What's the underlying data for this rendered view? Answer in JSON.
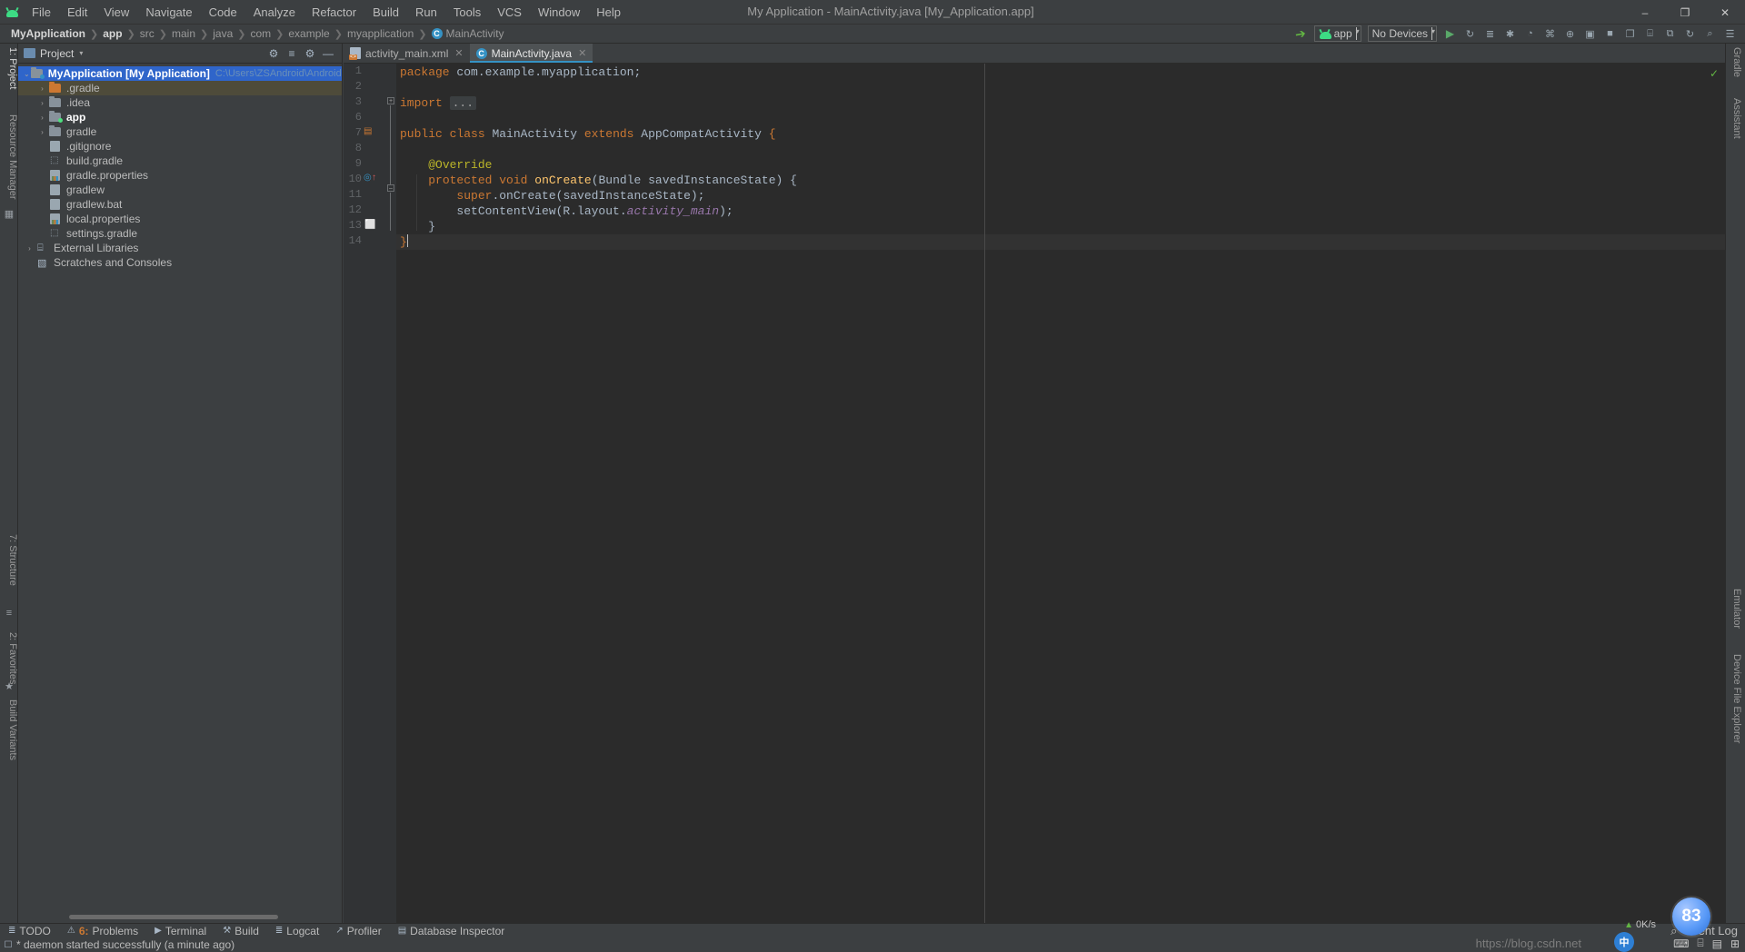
{
  "window": {
    "title": "My Application - MainActivity.java [My_Application.app]",
    "logo_icon": "android-logo-icon",
    "minimize_label": "–",
    "maximize_label": "❐",
    "close_label": "✕"
  },
  "menubar": {
    "items": [
      {
        "label": "File"
      },
      {
        "label": "Edit"
      },
      {
        "label": "View"
      },
      {
        "label": "Navigate"
      },
      {
        "label": "Code"
      },
      {
        "label": "Analyze"
      },
      {
        "label": "Refactor"
      },
      {
        "label": "Build"
      },
      {
        "label": "Run"
      },
      {
        "label": "Tools"
      },
      {
        "label": "VCS"
      },
      {
        "label": "Window"
      },
      {
        "label": "Help"
      }
    ]
  },
  "breadcrumb": {
    "items": [
      {
        "label": "MyApplication",
        "bold": true
      },
      {
        "label": "app",
        "bold": true
      },
      {
        "label": "src",
        "bold": false
      },
      {
        "label": "main",
        "bold": false
      },
      {
        "label": "java",
        "bold": false
      },
      {
        "label": "com",
        "bold": false
      },
      {
        "label": "example",
        "bold": false
      },
      {
        "label": "myapplication",
        "bold": false
      },
      {
        "label": "MainActivity",
        "bold": false,
        "badge": "C"
      }
    ],
    "separator": "❯"
  },
  "toolbar": {
    "build_icon": "hammer-icon",
    "run_config": {
      "label": "app",
      "icon": "android-app-icon",
      "caret": "▾"
    },
    "device_selector": {
      "label": "No Devices",
      "caret": "▾"
    },
    "run_icon": "run-play-icon",
    "rerun_icon": "apply-changes-icon",
    "debug_icon": "debug-bug-icon",
    "stop_icon": "stop-icon",
    "buttons": [
      {
        "name": "run-button",
        "glyph": "▶"
      },
      {
        "name": "apply-changes-button",
        "glyph": "↻"
      },
      {
        "name": "apply-code-changes-button",
        "glyph": "≣"
      },
      {
        "name": "debug-button",
        "glyph": "✱"
      },
      {
        "name": "profiler-button",
        "glyph": "◔"
      },
      {
        "name": "attach-debugger-button",
        "glyph": "⌘"
      },
      {
        "name": "sdk-manager-button",
        "glyph": "⊕"
      },
      {
        "name": "avd-manager-button",
        "glyph": "▣"
      },
      {
        "name": "stop-button",
        "glyph": "■"
      },
      {
        "name": "profile-or-debug-button",
        "glyph": "❐"
      },
      {
        "name": "layout-inspector-button",
        "glyph": "⌸"
      },
      {
        "name": "device-file-explorer-button",
        "glyph": "⧉"
      },
      {
        "name": "sync-gradle-button",
        "glyph": "↻"
      },
      {
        "name": "search-everywhere-button",
        "glyph": "⌕"
      },
      {
        "name": "settings-button",
        "glyph": "☰"
      }
    ]
  },
  "left_strip": {
    "items": [
      {
        "label": "1: Project",
        "name": "tool-window-project",
        "selected": true
      },
      {
        "label": "Resource Manager",
        "name": "tool-window-resource-manager",
        "selected": false
      },
      {
        "label": "7: Structure",
        "name": "tool-window-structure",
        "selected": false
      },
      {
        "label": "2: Favorites",
        "name": "tool-window-favorites",
        "selected": false
      },
      {
        "label": "Build Variants",
        "name": "tool-window-build-variants",
        "selected": false
      }
    ]
  },
  "right_strip": {
    "items": [
      {
        "label": "Gradle",
        "name": "tool-window-gradle"
      },
      {
        "label": "Assistant",
        "name": "tool-window-assistant"
      },
      {
        "label": "Emulator",
        "name": "tool-window-emulator"
      },
      {
        "label": "Device File Explorer",
        "name": "tool-window-device-file-explorer"
      }
    ]
  },
  "project_panel": {
    "header": {
      "title": "Project",
      "caret": "▾",
      "icons": [
        {
          "name": "project-scope-icon",
          "glyph": "⚙"
        },
        {
          "name": "collapse-all-icon",
          "glyph": "≡"
        },
        {
          "name": "settings-gear-icon",
          "glyph": "⚙"
        },
        {
          "name": "hide-panel-icon",
          "glyph": "—"
        }
      ]
    },
    "tree": [
      {
        "label": "MyApplication [My Application]",
        "path": "C:\\Users\\ZSAndroid\\AndroidStudio",
        "indent": 0,
        "arrow": "⌄",
        "icon": "module-folder-icon",
        "state": "selected",
        "bold": true,
        "dot": "blue"
      },
      {
        "label": ".gradle",
        "indent": 1,
        "arrow": "›",
        "icon": "excluded-folder-icon",
        "state": "highlight",
        "folderColor": "orange"
      },
      {
        "label": ".idea",
        "indent": 1,
        "arrow": "›",
        "icon": "folder-icon",
        "state": ""
      },
      {
        "label": "app",
        "indent": 1,
        "arrow": "›",
        "icon": "module-folder-icon",
        "state": "",
        "bold": true,
        "dot": "green"
      },
      {
        "label": "gradle",
        "indent": 1,
        "arrow": "›",
        "icon": "folder-icon",
        "state": ""
      },
      {
        "label": ".gitignore",
        "indent": 1,
        "arrow": "",
        "icon": "gitignore-file-icon",
        "state": ""
      },
      {
        "label": "build.gradle",
        "indent": 1,
        "arrow": "",
        "icon": "gradle-file-icon",
        "state": ""
      },
      {
        "label": "gradle.properties",
        "indent": 1,
        "arrow": "",
        "icon": "properties-file-icon",
        "state": ""
      },
      {
        "label": "gradlew",
        "indent": 1,
        "arrow": "",
        "icon": "shell-script-icon",
        "state": ""
      },
      {
        "label": "gradlew.bat",
        "indent": 1,
        "arrow": "",
        "icon": "batch-file-icon",
        "state": ""
      },
      {
        "label": "local.properties",
        "indent": 1,
        "arrow": "",
        "icon": "properties-file-icon",
        "state": ""
      },
      {
        "label": "settings.gradle",
        "indent": 1,
        "arrow": "",
        "icon": "gradle-file-icon",
        "state": ""
      },
      {
        "label": "External Libraries",
        "indent": 0,
        "arrow": "›",
        "icon": "external-libraries-icon",
        "state": ""
      },
      {
        "label": "Scratches and Consoles",
        "indent": 0,
        "arrow": "",
        "icon": "scratches-icon",
        "state": ""
      }
    ]
  },
  "editor": {
    "tabs": [
      {
        "label": "activity_main.xml",
        "icon": "xml-layout-file-icon",
        "active": false,
        "close": "✕"
      },
      {
        "label": "MainActivity.java",
        "icon": "java-class-icon",
        "active": true,
        "close": "✕"
      }
    ],
    "line_numbers": [
      "1",
      "2",
      "3",
      "6",
      "7",
      "8",
      "9",
      "10",
      "11",
      "12",
      "13",
      "14"
    ],
    "caret_line_index": 11,
    "inspection_status_icon": "checkmark-ok-icon",
    "gutter_markers": [
      {
        "line_index": 3,
        "glyph": "⊞",
        "name": "fold-expand-icon"
      },
      {
        "line_index": 4,
        "glyph": "▤",
        "name": "class-gutter-icon"
      },
      {
        "line_index": 7,
        "glyph": "⊕",
        "name": "overriding-method-icon"
      },
      {
        "line_index": 7,
        "glyph": "⊟",
        "name": "fold-collapse-icon"
      },
      {
        "line_index": 10,
        "glyph": "ὑ2",
        "name": "lock-icon"
      }
    ],
    "code_lines": [
      {
        "n": "1",
        "tokens": [
          {
            "t": "package",
            "c": "kw"
          },
          {
            "t": " com.example.myapplication;",
            "c": "plain"
          }
        ]
      },
      {
        "n": "2",
        "tokens": []
      },
      {
        "n": "3",
        "tokens": [
          {
            "t": "import",
            "c": "kw"
          },
          {
            "t": " ",
            "c": "plain"
          },
          {
            "t": "...",
            "c": "fold"
          }
        ]
      },
      {
        "n": "6",
        "tokens": []
      },
      {
        "n": "7",
        "tokens": [
          {
            "t": "public",
            "c": "kw"
          },
          {
            "t": " ",
            "c": "plain"
          },
          {
            "t": "class",
            "c": "kw"
          },
          {
            "t": " MainActivity ",
            "c": "plain"
          },
          {
            "t": "extends",
            "c": "kw"
          },
          {
            "t": " AppCompatActivity ",
            "c": "plain"
          },
          {
            "t": "{",
            "c": "brace"
          }
        ]
      },
      {
        "n": "8",
        "tokens": []
      },
      {
        "n": "9",
        "tokens": [
          {
            "t": "    ",
            "c": "plain"
          },
          {
            "t": "@Override",
            "c": "anno"
          }
        ]
      },
      {
        "n": "10",
        "tokens": [
          {
            "t": "    ",
            "c": "plain"
          },
          {
            "t": "protected",
            "c": "kw"
          },
          {
            "t": " ",
            "c": "plain"
          },
          {
            "t": "void",
            "c": "kw"
          },
          {
            "t": " ",
            "c": "plain"
          },
          {
            "t": "onCreate",
            "c": "mname"
          },
          {
            "t": "(Bundle savedInstanceState) {",
            "c": "plain"
          }
        ]
      },
      {
        "n": "11",
        "tokens": [
          {
            "t": "        ",
            "c": "plain"
          },
          {
            "t": "super",
            "c": "kw"
          },
          {
            "t": ".onCreate(savedInstanceState);",
            "c": "plain"
          }
        ]
      },
      {
        "n": "12",
        "tokens": [
          {
            "t": "        setContentView(R.layout.",
            "c": "plain"
          },
          {
            "t": "activity_main",
            "c": "fld"
          },
          {
            "t": ");",
            "c": "plain"
          }
        ]
      },
      {
        "n": "13",
        "tokens": [
          {
            "t": "    }",
            "c": "plain"
          }
        ]
      },
      {
        "n": "14",
        "tokens": [
          {
            "t": "}",
            "c": "brace"
          }
        ]
      }
    ]
  },
  "bottom_bar": {
    "items": [
      {
        "label": "TODO",
        "icon": "todo-icon",
        "glyph": "≣",
        "num": ""
      },
      {
        "label": "Problems",
        "icon": "problems-icon",
        "glyph": "⚠",
        "num": "6:"
      },
      {
        "label": "Terminal",
        "icon": "terminal-icon",
        "glyph": "▶"
      },
      {
        "label": "Build",
        "icon": "build-hammer-icon",
        "glyph": "⚒"
      },
      {
        "label": "Logcat",
        "icon": "logcat-icon",
        "glyph": "≣"
      },
      {
        "label": "Profiler",
        "icon": "profiler-icon",
        "glyph": "↗"
      },
      {
        "label": "Database Inspector",
        "icon": "database-icon",
        "glyph": "▤"
      }
    ],
    "event_log": {
      "label": "Event Log",
      "icon": "event-log-icon",
      "glyph": "⌕"
    }
  },
  "status_bar": {
    "icon": "build-status-icon",
    "message": "* daemon started successfully (a minute ago)",
    "watermark": "https://blog.csdn.net"
  },
  "overlays": {
    "network_speed": {
      "value": "0K/s",
      "arrow": "▲"
    },
    "temperature_badge": "83",
    "ime_badge": "中",
    "tray": [
      {
        "name": "tray-keyboard-icon",
        "glyph": "⌨"
      },
      {
        "name": "tray-monitor-icon",
        "glyph": "⌸"
      },
      {
        "name": "tray-folder-icon",
        "glyph": "▤"
      },
      {
        "name": "tray-grid-icon",
        "glyph": "⊞"
      }
    ]
  },
  "colors": {
    "accent_blue": "#3592c4",
    "selection_blue": "#2f65ca",
    "keyword_orange": "#cc7832",
    "method_yellow": "#ffc66d",
    "annotation_olive": "#bbb529",
    "field_purple": "#9876aa",
    "android_green": "#3ddc84",
    "panel_bg": "#3c3f41",
    "editor_bg": "#2b2b2b",
    "gutter_bg": "#313335"
  }
}
